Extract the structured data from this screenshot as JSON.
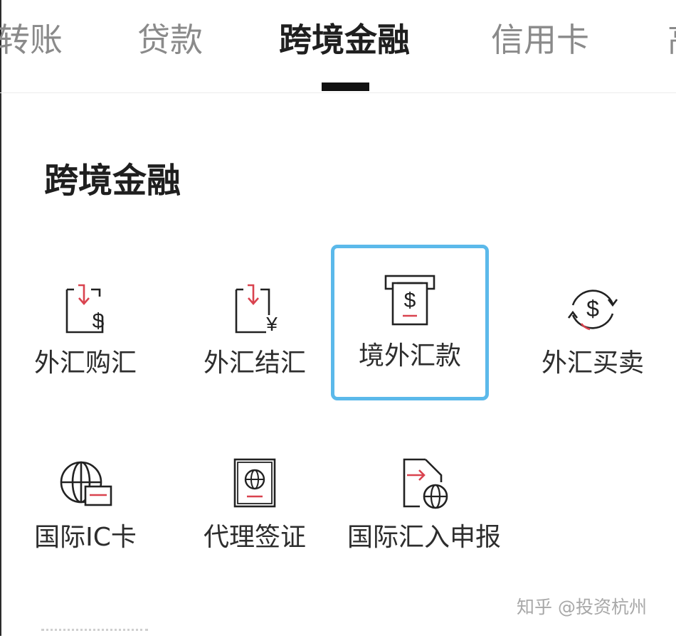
{
  "tabs": [
    {
      "label": "转账"
    },
    {
      "label": "贷款"
    },
    {
      "label": "跨境金融",
      "active": true
    },
    {
      "label": "信用卡"
    },
    {
      "label": "高"
    }
  ],
  "section": {
    "title": "跨境金融"
  },
  "items": [
    {
      "label": "外汇购汇",
      "icon": "receipt-dollar-icon"
    },
    {
      "label": "外汇结汇",
      "icon": "receipt-yen-icon"
    },
    {
      "label": "境外汇款",
      "icon": "atm-dollar-icon",
      "selected": true
    },
    {
      "label": "外汇买卖",
      "icon": "dollar-exchange-icon"
    },
    {
      "label": "国际IC卡",
      "icon": "globe-card-icon"
    },
    {
      "label": "代理签证",
      "icon": "passport-icon"
    },
    {
      "label": "国际汇入申报",
      "icon": "document-globe-icon"
    }
  ],
  "watermark": "知乎 @投资杭州",
  "colors": {
    "accent_red": "#d9434f",
    "selection_border": "#5bb9ea",
    "icon_stroke": "#222222"
  }
}
